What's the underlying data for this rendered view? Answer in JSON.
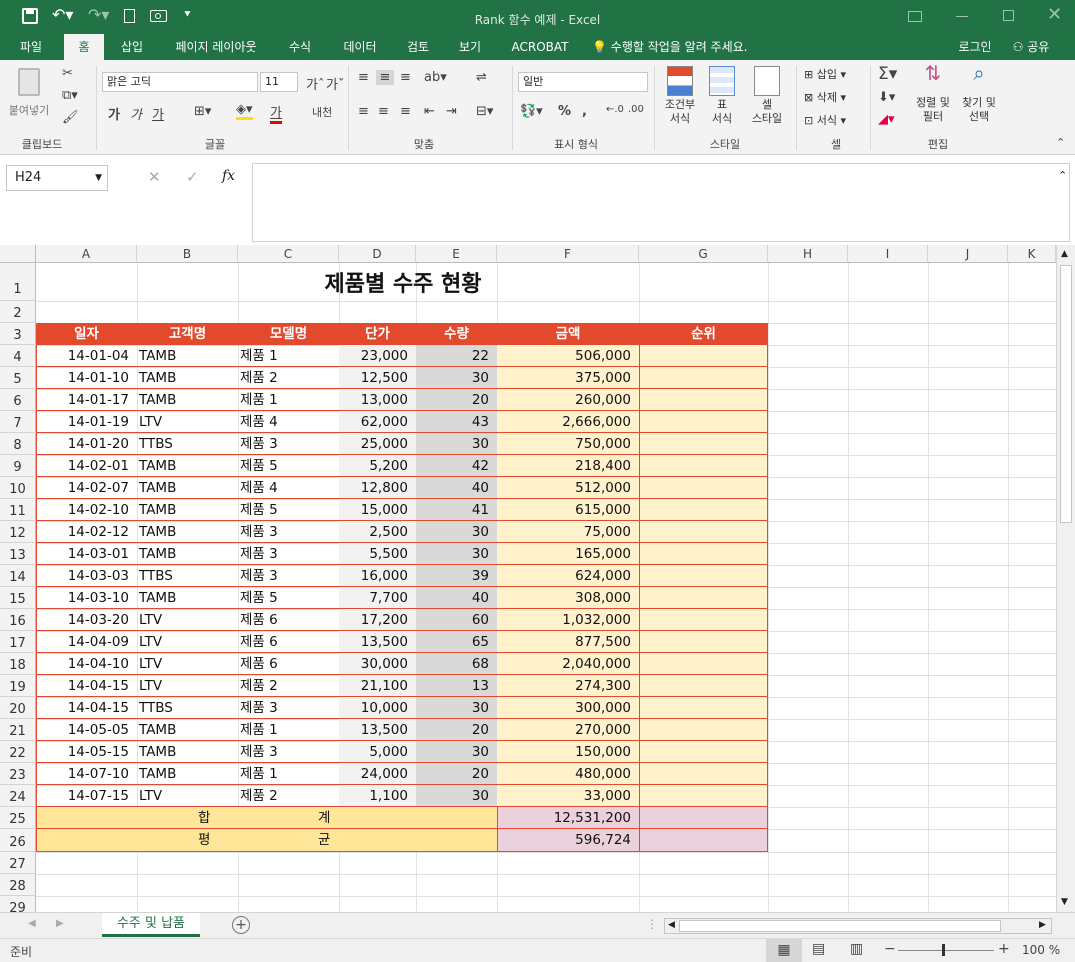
{
  "window": {
    "title": "Rank 함수 예제 - Excel"
  },
  "tabs": [
    "파일",
    "홈",
    "삽입",
    "페이지 레이아웃",
    "수식",
    "데이터",
    "검토",
    "보기",
    "ACROBAT"
  ],
  "tell_me": "수행할 작업을 알려 주세요.",
  "login": "로그인",
  "share": "공유",
  "ribbon": {
    "paste": "붙여넣기",
    "font_name": "맑은 고딕",
    "font_size": "11",
    "number_format": "일반",
    "groups": {
      "clipboard": "클립보드",
      "font": "글꼴",
      "align": "맞춤",
      "number": "표시 형식",
      "style": "스타일",
      "cells": "셀",
      "edit": "편집"
    },
    "cond_format": [
      "조건부",
      "서식"
    ],
    "table_format": [
      "표",
      "서식"
    ],
    "cell_style": [
      "셀",
      "스타일"
    ],
    "insert": "삽입",
    "delete": "삭제",
    "format": "서식",
    "sort_filter": [
      "정렬 및",
      "필터"
    ],
    "find_select": [
      "찾기 및",
      "선택"
    ],
    "bold": "가",
    "italic": "가",
    "underline": "가",
    "font_color_letter": "가",
    "wrap": "내천"
  },
  "namebox": "H24",
  "fx": "fx",
  "columns": [
    "A",
    "B",
    "C",
    "D",
    "E",
    "F",
    "G",
    "H",
    "I",
    "J",
    "K"
  ],
  "sheet_title": "제품별 수주 현황",
  "headers": [
    "일자",
    "고객명",
    "모델명",
    "단가",
    "수량",
    "금액",
    "순위"
  ],
  "rows": [
    [
      "14-01-04",
      "TAMB",
      "제품 1",
      "23,000",
      "22",
      "506,000"
    ],
    [
      "14-01-10",
      "TAMB",
      "제품 2",
      "12,500",
      "30",
      "375,000"
    ],
    [
      "14-01-17",
      "TAMB",
      "제품 1",
      "13,000",
      "20",
      "260,000"
    ],
    [
      "14-01-19",
      "LTV",
      "제품 4",
      "62,000",
      "43",
      "2,666,000"
    ],
    [
      "14-01-20",
      "TTBS",
      "제품 3",
      "25,000",
      "30",
      "750,000"
    ],
    [
      "14-02-01",
      "TAMB",
      "제품 5",
      "5,200",
      "42",
      "218,400"
    ],
    [
      "14-02-07",
      "TAMB",
      "제품 4",
      "12,800",
      "40",
      "512,000"
    ],
    [
      "14-02-10",
      "TAMB",
      "제품 5",
      "15,000",
      "41",
      "615,000"
    ],
    [
      "14-02-12",
      "TAMB",
      "제품 3",
      "2,500",
      "30",
      "75,000"
    ],
    [
      "14-03-01",
      "TAMB",
      "제품 3",
      "5,500",
      "30",
      "165,000"
    ],
    [
      "14-03-03",
      "TTBS",
      "제품 3",
      "16,000",
      "39",
      "624,000"
    ],
    [
      "14-03-10",
      "TAMB",
      "제품 5",
      "7,700",
      "40",
      "308,000"
    ],
    [
      "14-03-20",
      "LTV",
      "제품 6",
      "17,200",
      "60",
      "1,032,000"
    ],
    [
      "14-04-09",
      "LTV",
      "제품 6",
      "13,500",
      "65",
      "877,500"
    ],
    [
      "14-04-10",
      "LTV",
      "제품 6",
      "30,000",
      "68",
      "2,040,000"
    ],
    [
      "14-04-15",
      "LTV",
      "제품 2",
      "21,100",
      "13",
      "274,300"
    ],
    [
      "14-04-15",
      "TTBS",
      "제품 3",
      "10,000",
      "30",
      "300,000"
    ],
    [
      "14-05-05",
      "TAMB",
      "제품 1",
      "13,500",
      "20",
      "270,000"
    ],
    [
      "14-05-15",
      "TAMB",
      "제품 3",
      "5,000",
      "30",
      "150,000"
    ],
    [
      "14-07-10",
      "TAMB",
      "제품 1",
      "24,000",
      "20",
      "480,000"
    ],
    [
      "14-07-15",
      "LTV",
      "제품 2",
      "1,100",
      "30",
      "33,000"
    ]
  ],
  "total": {
    "label_a": "합",
    "label_b": "계",
    "value": "12,531,200"
  },
  "average": {
    "label_a": "평",
    "label_b": "균",
    "value": "596,724"
  },
  "row_numbers": [
    "1",
    "2",
    "3",
    "4",
    "5",
    "6",
    "7",
    "8",
    "9",
    "10",
    "11",
    "12",
    "13",
    "14",
    "15",
    "16",
    "17",
    "18",
    "19",
    "20",
    "21",
    "22",
    "23",
    "24",
    "25",
    "26",
    "27",
    "28",
    "29"
  ],
  "sheet_tab": "수주 및 납품",
  "status": {
    "ready": "준비",
    "zoom": "100 %"
  },
  "colors": {
    "ribbon_green": "#217346",
    "header_red": "#e2492d",
    "rank_fill": "#fff2cc",
    "total_fill": "#ffe699",
    "sum_fill": "#ead1dc",
    "qty_fill": "#d9d9d9",
    "price_fill": "#f2f2f2"
  }
}
